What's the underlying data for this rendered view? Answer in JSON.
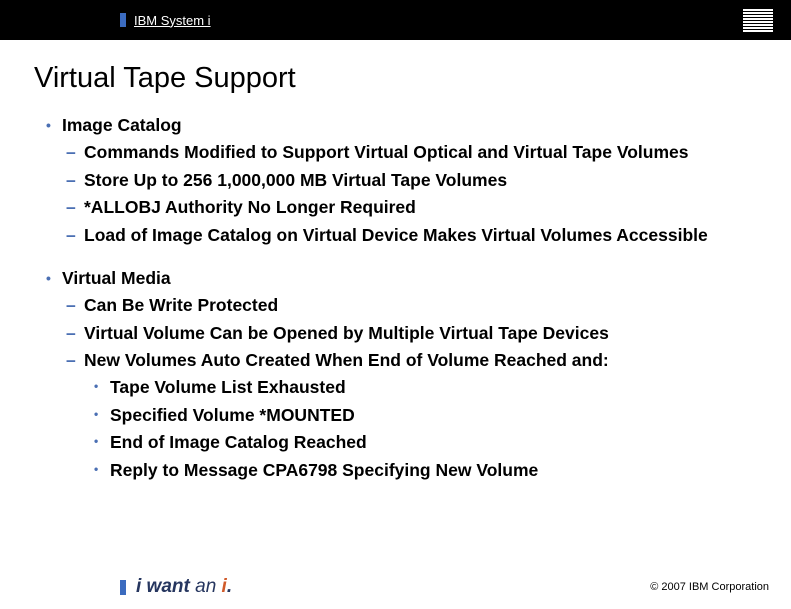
{
  "header": {
    "product_line": "IBM System i",
    "logo_name": "ibm-logo"
  },
  "title": "Virtual Tape Support",
  "sections": [
    {
      "heading": "Image Catalog",
      "items": [
        {
          "text": "Commands Modified to Support Virtual Optical and Virtual Tape Volumes"
        },
        {
          "text": "Store Up to 256 1,000,000 MB Virtual Tape Volumes"
        },
        {
          "text": "*ALLOBJ Authority No Longer Required"
        },
        {
          "text": "Load of Image Catalog on Virtual Device Makes Virtual Volumes Accessible"
        }
      ]
    },
    {
      "heading": "Virtual Media",
      "items": [
        {
          "text": "Can Be Write Protected"
        },
        {
          "text": "Virtual Volume Can be Opened by Multiple Virtual Tape Devices"
        },
        {
          "text": "New Volumes Auto Created When End of Volume Reached and:",
          "subitems": [
            "Tape Volume List Exhausted",
            "Specified Volume *MOUNTED",
            "End of Image Catalog Reached",
            "Reply to Message CPA6798 Specifying New Volume"
          ]
        }
      ]
    }
  ],
  "footer": {
    "tagline_prefix": "i want ",
    "tagline_an": "an ",
    "tagline_i": "i",
    "tagline_dot": ".",
    "copyright": "© 2007 IBM Corporation"
  }
}
